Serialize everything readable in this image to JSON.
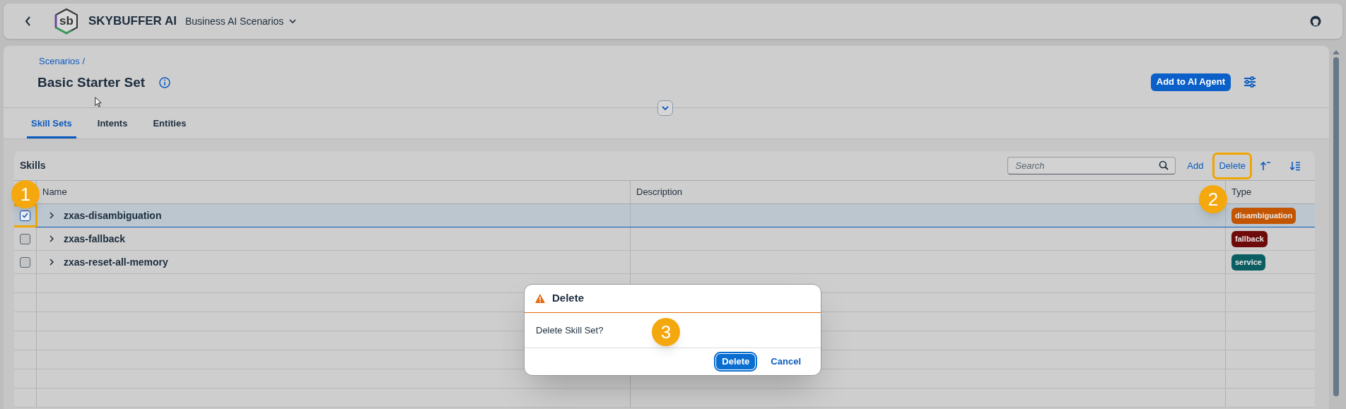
{
  "app_bar": {
    "logo_text": "sb",
    "title": "SKYBUFFER AI",
    "menu": "Business AI Scenarios"
  },
  "page": {
    "breadcrumb": "Scenarios /",
    "title": "Basic Starter Set",
    "primary_action": "Add to AI Agent"
  },
  "tabs": [
    {
      "label": "Skill Sets",
      "selected": true
    },
    {
      "label": "Intents",
      "selected": false
    },
    {
      "label": "Entities",
      "selected": false
    }
  ],
  "table": {
    "title": "Skills",
    "search": {
      "placeholder": "Search"
    },
    "actions": [
      {
        "label": "Add",
        "highlighted": false
      },
      {
        "label": "Delete",
        "highlighted": true
      }
    ],
    "columns": [
      "Name",
      "Description",
      "Type"
    ],
    "rows": [
      {
        "name": "zxas-disambiguation",
        "checked": true,
        "selected": true,
        "highlighted": true,
        "type": "disambiguation",
        "color": "#c35500"
      },
      {
        "name": "zxas-fallback",
        "checked": false,
        "selected": false,
        "highlighted": false,
        "type": "fallback",
        "color": "#6e0a0a"
      },
      {
        "name": "zxas-reset-all-memory",
        "checked": false,
        "selected": false,
        "highlighted": false,
        "type": "service",
        "color": "#0b5f63"
      }
    ]
  },
  "dialog": {
    "title": "Delete",
    "message": "Delete Skill Set?",
    "buttons": [
      {
        "label": "Delete",
        "kind": "emphasized"
      },
      {
        "label": "Cancel",
        "kind": "transparent"
      }
    ]
  },
  "callouts": [
    "1",
    "2",
    "3"
  ]
}
